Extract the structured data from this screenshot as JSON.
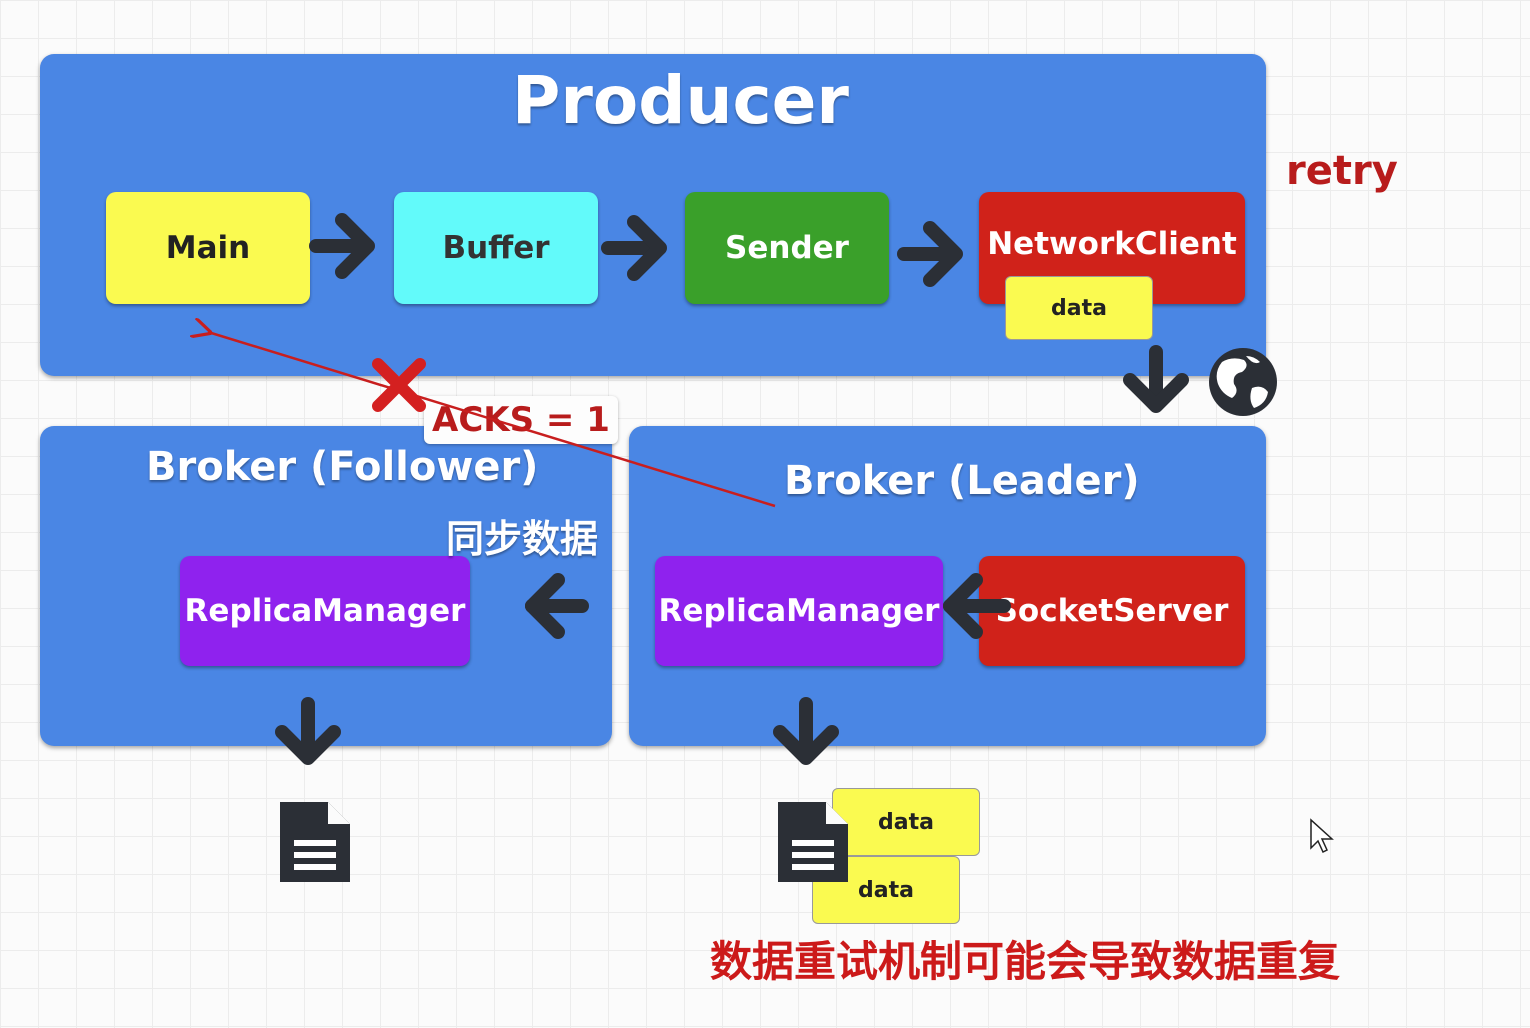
{
  "producer": {
    "title": "Producer",
    "components": [
      "Main",
      "Buffer",
      "Sender",
      "NetworkClient"
    ],
    "data_chip": "data"
  },
  "retry_label": "retry",
  "acks_label": "ACKS = 1",
  "follower": {
    "title": "Broker (Follower)",
    "replica_manager": "ReplicaManager"
  },
  "leader": {
    "title": "Broker (Leader)",
    "replica_manager": "ReplicaManager",
    "socket_server": "SocketServer"
  },
  "sync_label": "同步数据",
  "storage_chips": [
    "data",
    "data"
  ],
  "note": "数据重试机制可能会导致数据重复",
  "colors": {
    "panel": "#4a86e4",
    "main": "#fafa50",
    "buffer": "#62fafa",
    "sender": "#3aa02a",
    "network_client": "#d0221a",
    "replica_manager": "#8f22ee",
    "accent_red": "#cc1a1a"
  },
  "icons": [
    "arrow-right-icon",
    "arrow-down-icon",
    "arrow-left-icon",
    "globe-icon",
    "cross-icon",
    "document-icon",
    "cursor-icon"
  ]
}
